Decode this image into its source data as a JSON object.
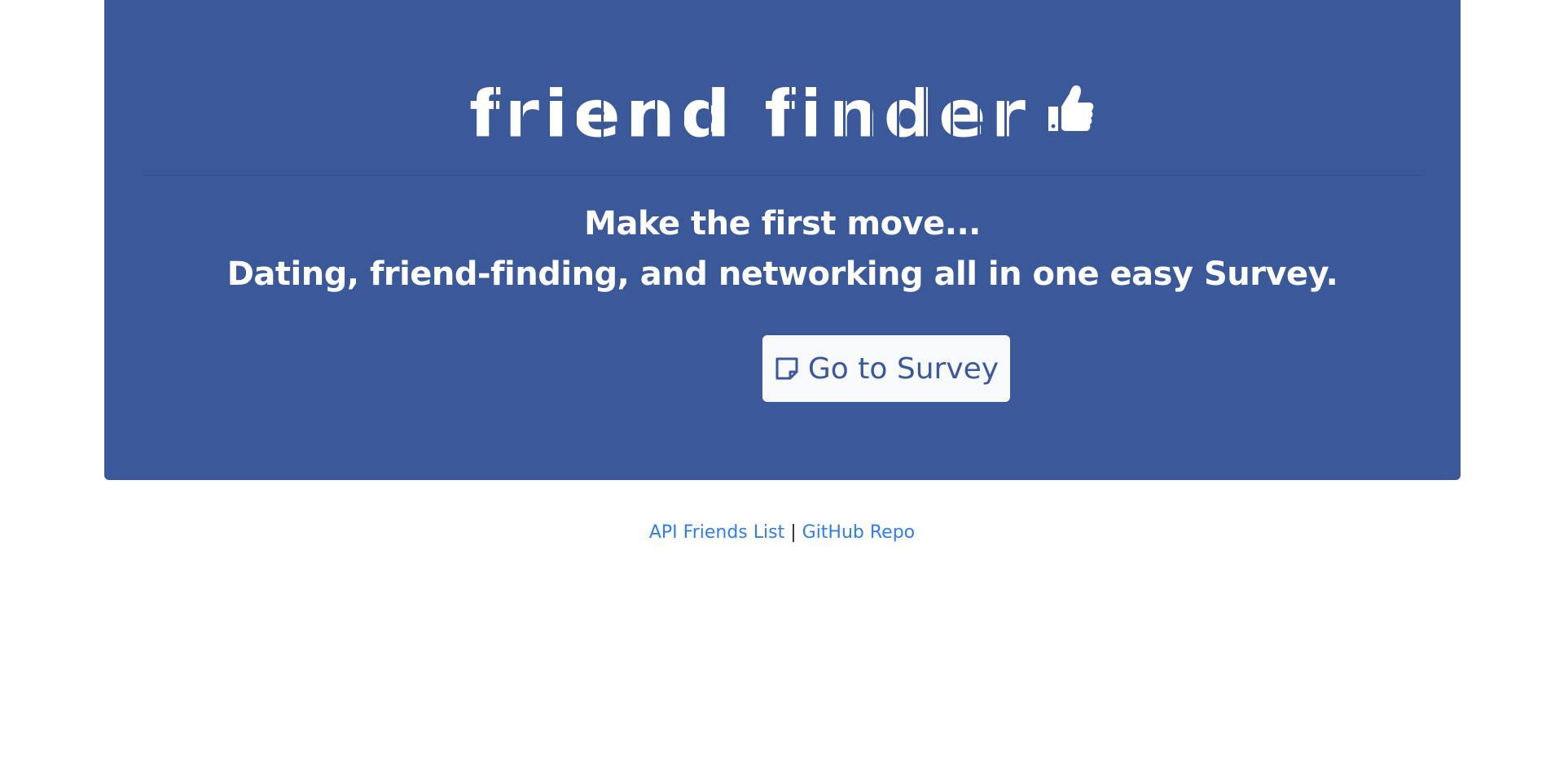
{
  "header": {
    "logo_text": "friend finder",
    "tagline_1": "Make the first move...",
    "tagline_2": "Dating, friend-finding, and networking all in one easy Survey."
  },
  "icons": {
    "logo_icon": "thumbs-up-icon",
    "button_icon": "sticky-note-icon"
  },
  "actions": {
    "survey_label": "Go to Survey"
  },
  "footer": {
    "api_link": "API Friends List",
    "separator": "|",
    "github_link": "GitHub Repo"
  },
  "colors": {
    "brand_blue": "#3b5998",
    "link_blue": "#2f7ee8",
    "button_bg": "#f8f9fa"
  }
}
